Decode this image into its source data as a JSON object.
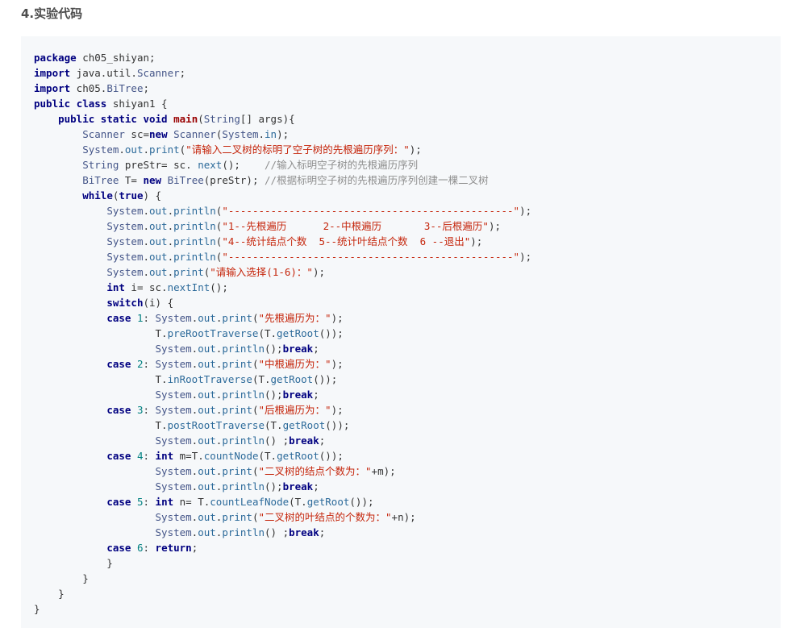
{
  "section": {
    "heading": "4.实验代码"
  },
  "code": {
    "language": "java",
    "lines": [
      "package ch05_shiyan;",
      "import java.util.Scanner;",
      "import ch05.BiTree;",
      "public class shiyan1 {",
      "    public static void main(String[] args){",
      "        Scanner sc=new Scanner(System.in);",
      "        System.out.print(\"请输入二叉树的标明了空子树的先根遍历序列：\");",
      "        String preStr= sc. next();    //输入标明空子树的先根遍历序列",
      "        BiTree T= new BiTree(preStr); //根据标明空子树的先根遍历序列创建一棵二叉树",
      "        while(true) {",
      "            System.out.println(\"-----------------------------------------------\");",
      "            System.out.println(\"1--先根遍历      2--中根遍历       3--后根遍历\");",
      "            System.out.println(\"4--统计结点个数  5--统计叶结点个数  6 --退出\");",
      "            System.out.println(\"-----------------------------------------------\");",
      "            System.out.print(\"请输入选择(1-6)：\");",
      "            int i= sc.nextInt();",
      "            switch(i) {",
      "            case 1: System.out.print(\"先根遍历为：\");",
      "                    T.preRootTraverse(T.getRoot());",
      "                    System.out.println();break;",
      "            case 2: System.out.print(\"中根遍历为：\");",
      "                    T.inRootTraverse(T.getRoot());",
      "                    System.out.println();break;",
      "            case 3: System.out.print(\"后根遍历为：\");",
      "                    T.postRootTraverse(T.getRoot());",
      "                    System.out.println() ;break;",
      "            case 4: int m=T.countNode(T.getRoot());",
      "                    System.out.print(\"二叉树的结点个数为：\"+m);",
      "                    System.out.println();break;",
      "            case 5: int n= T.countLeafNode(T.getRoot());",
      "                    System.out.print(\"二叉树的叶结点的个数为：\"+n);",
      "                    System.out.println() ;break;",
      "            case 6: return;",
      "            }",
      "        }",
      "    }",
      "}"
    ]
  }
}
